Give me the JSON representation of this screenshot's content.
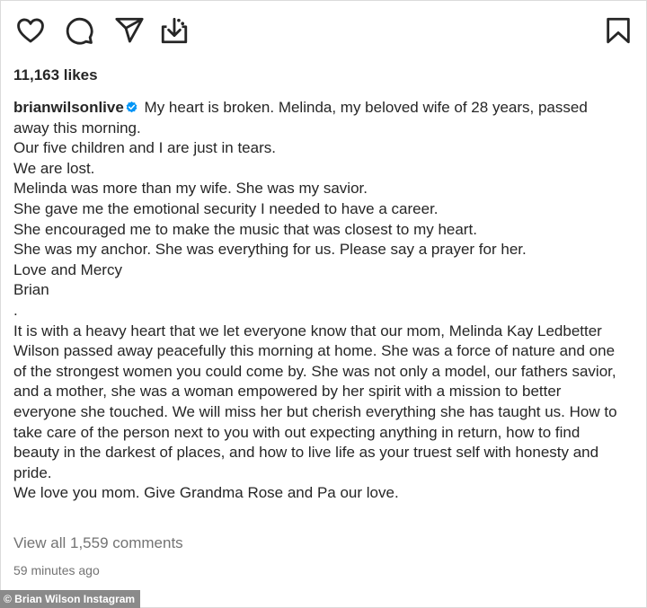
{
  "actions": {
    "like_icon": "heart-icon",
    "comment_icon": "comment-bubble-icon",
    "share_icon": "paper-plane-icon",
    "save_reel_icon": "download-icon",
    "bookmark_icon": "bookmark-icon"
  },
  "likes": "11,163 likes",
  "post": {
    "username": "brianwilsonlive",
    "verified": true,
    "first_line": " My heart is broken. Melinda, my beloved wife of 28 years, passed away this morning.",
    "lines": [
      "Our five children and I are just in tears.",
      "We are lost.",
      "Melinda was more than my wife. She was my savior.",
      "She gave me the emotional security I needed to have a career.",
      "She encouraged me to make the music that was closest to my heart.",
      "She was my anchor. She was everything for us. Please say a prayer for her.",
      "Love and Mercy",
      "Brian",
      "."
    ],
    "family_paragraph": "It is with a heavy heart that we let everyone know that our mom, Melinda Kay Ledbetter Wilson passed away peacefully this morning at home. She was a force of nature and one of the strongest women you could come by. She was not only a model, our fathers savior, and a mother, she was a woman empowered by her spirit with a mission to better everyone she touched. We will miss her but cherish everything she has taught us. How to take care of the person next to you with out expecting anything in return, how to find beauty in the darkest of places, and how to live life as your truest self with honesty and pride.",
    "closing": "We love you mom. Give Grandma Rose and Pa our love."
  },
  "view_comments": "View all 1,559 comments",
  "timestamp": "59 minutes ago",
  "credit": "© Brian Wilson Instagram",
  "colors": {
    "text": "#262626",
    "muted": "#737373",
    "verified": "#0095f6"
  }
}
